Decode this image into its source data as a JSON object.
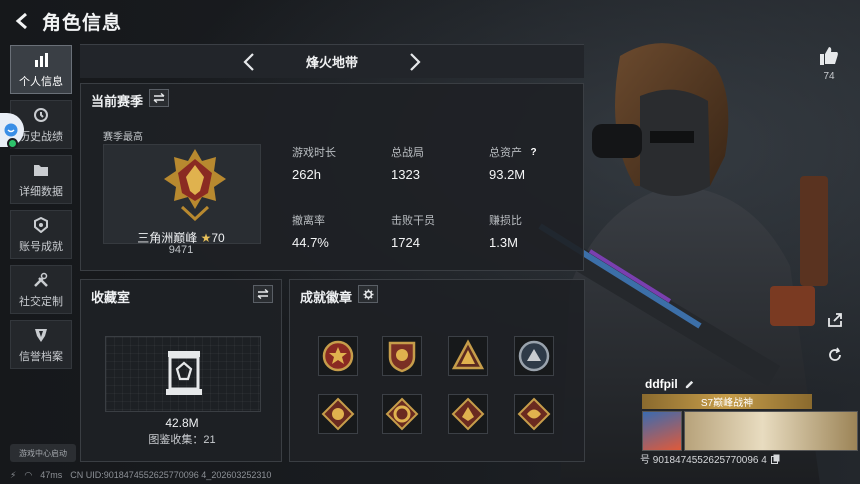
{
  "header": {
    "title": "角色信息"
  },
  "sidebar": {
    "items": [
      {
        "label": "个人信息",
        "icon": "bar-chart-icon",
        "active": true
      },
      {
        "label": "历史战绩",
        "icon": "history-icon",
        "active": false
      },
      {
        "label": "详细数据",
        "icon": "folder-icon",
        "active": false
      },
      {
        "label": "账号成就",
        "icon": "achievement-icon",
        "active": false
      },
      {
        "label": "社交定制",
        "icon": "wrench-icon",
        "active": false
      },
      {
        "label": "信誉档案",
        "icon": "shield-icon",
        "active": false
      }
    ],
    "game_center_label": "游戏中心启动"
  },
  "mode": {
    "title": "烽火地带"
  },
  "season": {
    "title": "当前赛季",
    "best_label": "赛季最高",
    "rank_name": "三角洲巅峰",
    "rank_stars": "70",
    "rank_score": "9471",
    "stats": [
      {
        "key": "游戏时长",
        "value": "262h"
      },
      {
        "key": "总战局",
        "value": "1323"
      },
      {
        "key": "总资产",
        "value": "93.2M",
        "help": "?"
      },
      {
        "key": "撤离率",
        "value": "44.7%"
      },
      {
        "key": "击败干员",
        "value": "1724"
      },
      {
        "key": "赚损比",
        "value": "1.3M"
      }
    ]
  },
  "collection": {
    "title": "收藏室",
    "value": "42.8M",
    "collect_label": "图鉴收集：21"
  },
  "badges": {
    "title": "成就徽章",
    "count_shown": 8
  },
  "player": {
    "likes": "74",
    "name": "ddfpil",
    "title": "S7巅峰战神",
    "uid_line": "号 9018474552625770096 4"
  },
  "status": {
    "ping": "47ms",
    "uid_text": "CN UID:9018474552625770096 4_202603252310"
  },
  "colors": {
    "accent_gold": "#c69d4a",
    "panel_bg": "#1e2125",
    "active_tab": "#3a3f45"
  }
}
